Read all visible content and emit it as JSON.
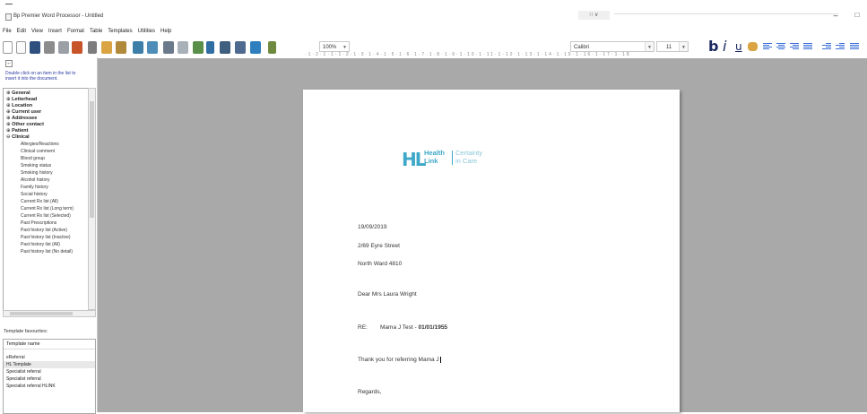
{
  "window": {
    "title": "Bp Premier Word Processor - Untitled",
    "quick_box": "∷ ∨",
    "minimize_glyph": "–",
    "maximize_glyph": "□"
  },
  "menu": [
    "File",
    "Edit",
    "View",
    "Insert",
    "Format",
    "Table",
    "Templates",
    "Utilities",
    "Help"
  ],
  "toolbar": {
    "zoom": "100%",
    "font": "Calibri",
    "font_size": "11",
    "bold": "b",
    "italic": "i",
    "underline": "u",
    "icons": [
      "new-document-icon",
      "blank-page-icon",
      "save-icon",
      "print-icon",
      "print-preview-icon",
      "spellcheck-icon",
      "cut-icon",
      "copy-icon",
      "paste-icon",
      "undo-icon",
      "redo-icon",
      "find-icon",
      "insert-table-icon",
      "insert-field-icon",
      "insert-date-icon",
      "insert-image-icon",
      "insert-row-icon",
      "highlink-icon",
      "bottle-icon"
    ]
  },
  "ruler": "·1·2·1·1·1·2·1·3·1·4·1·5·1·6·1·7·1·8·1·9·1·10·1·11·1·12·1·13·1·14·1·15·1·16·1·17·1·18",
  "left_panel": {
    "hint": "Double click on an item in the list to insert it into the document.",
    "tree_parents": [
      "General",
      "Letterhead",
      "Location",
      "Current user",
      "Addressee",
      "Other contact",
      "Patient",
      "Clinical"
    ],
    "tree_children": [
      "Allergies/Reactions",
      "Clinical comment",
      "Blood group",
      "Smoking status",
      "Smoking history",
      "Alcohol history",
      "Family history",
      "Social history",
      "Current Rx list (All)",
      "Current Rx list (Long term)",
      "Current Rx list (Selected)",
      "Past Prescriptions",
      "Past history list (Active)",
      "Past history list (Inactive)",
      "Past history list (All)",
      "Past history list (No detail)"
    ],
    "favourites_label": "Template favourites:",
    "favourites_header": "Template name",
    "favourites": [
      "eReferral",
      "HL Template",
      "Specialist referral",
      "Specialist referral",
      "Specialist referral HLINK"
    ]
  },
  "document": {
    "logo": {
      "mark": "HL",
      "word1": "Health",
      "word2": "Link",
      "tag1": "Certainty",
      "tag2": "in Care"
    },
    "date": "19/09/2019",
    "address1": "2/69 Eyre Street",
    "address2": "North Ward  4810",
    "salutation": "Dear Mrs Laura Wright",
    "re_label": "RE:",
    "re_name": "Mama J Test - ",
    "re_dob": "01/01/1955",
    "body": "Thank you for referring Mama J",
    "closing": "Regards,"
  },
  "colors": {
    "accent": "#3ea8c8",
    "format_buttons": "#1a2860",
    "workspace": "#a9a9a9"
  }
}
